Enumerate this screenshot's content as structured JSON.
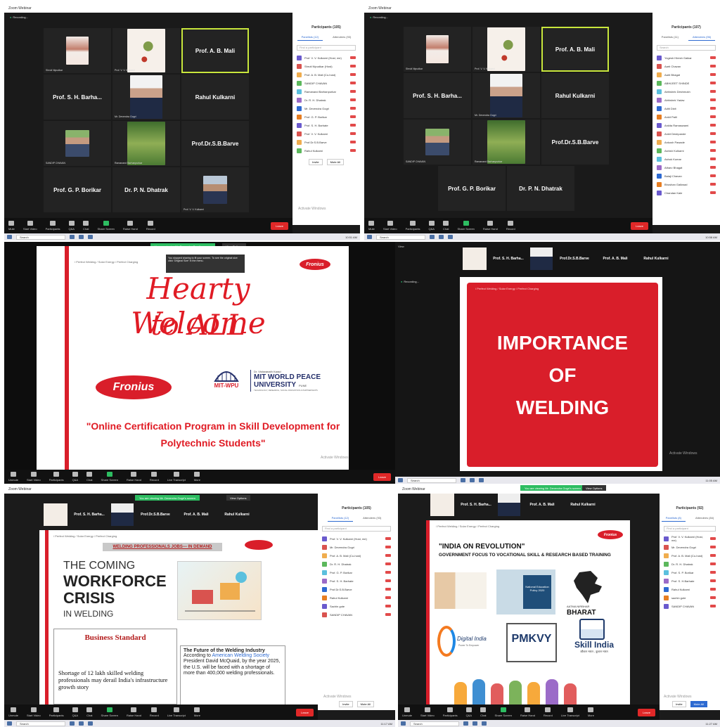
{
  "panel1": {
    "window_title": "Zoom Webinar",
    "recording": "Recording...",
    "tiles": [
      {
        "kind": "photo",
        "photo": "woman",
        "name": "Shruti Nipudkar"
      },
      {
        "kind": "photo",
        "photo": "bird",
        "name": "Prof. V. V. Kulkarni"
      },
      {
        "kind": "text",
        "label": "Prof. A. B. Mali",
        "active": true
      },
      {
        "kind": "text",
        "label": "Prof. S. H. Barha..."
      },
      {
        "kind": "photo",
        "photo": "suit",
        "name": "Mr. Devendra Gogri"
      },
      {
        "kind": "text",
        "label": "Rahul Kulkarni"
      },
      {
        "kind": "photo",
        "photo": "green",
        "name": "SANDIP CHAVAN"
      },
      {
        "kind": "photo",
        "photo": "outdoor",
        "name": "Ramanand Barhanpurkar"
      },
      {
        "kind": "text",
        "label": "Prof.Dr.S.B.Barve"
      },
      {
        "kind": "text",
        "label": "Prof. G. P. Borikar"
      },
      {
        "kind": "text",
        "label": "Dr. P. N. Dhatrak"
      },
      {
        "kind": "photo",
        "photo": "man2",
        "name": "Prof. V. V. Kulkarni"
      }
    ],
    "participants_title": "Participants (105)",
    "tab_panelists": "Panelists (12)",
    "tab_attendees": "Attendees (93)",
    "search_placeholder": "Find a participant",
    "participants": [
      "Prof. V. V. Kulkarni (Host, me)",
      "Shruti Nipudkar (Host)",
      "Prof. A. B. Mali (Co-host)",
      "SANDIP CHAVAN",
      "Ramanand Barhanpurkar",
      "Dr. R. H. Dhatrak",
      "Mr. Devendra Gogri",
      "Prof. G. P. Borikar",
      "Prof. S. H. Barhate",
      "Prof. V. V. Kulkarni",
      "Prof.Dr.S.B.Barve",
      "Rahul Kulkarni"
    ],
    "invite": "Invite",
    "mute_all": "Mute All",
    "toolbar": [
      "Mute",
      "Start Video",
      "Participants",
      "Q&A",
      "Chat",
      "Share Screen",
      "Raise Hand",
      "Record"
    ],
    "participant_count": "105",
    "leave": "Leave",
    "activate": "Activate Windows",
    "search": "Search",
    "time": "10:51 AM"
  },
  "panel2": {
    "window_title": "Zoom Webinar",
    "recording": "Recording...",
    "tiles": [
      {
        "kind": "photo",
        "photo": "woman",
        "name": "Shruti Nipudkar"
      },
      {
        "kind": "photo",
        "photo": "bird",
        "name": "Prof. V. V. Kulkarni"
      },
      {
        "kind": "text",
        "label": "Prof. A. B. Mali",
        "active": true
      },
      {
        "kind": "text",
        "label": "Prof. S. H. Barha..."
      },
      {
        "kind": "photo",
        "photo": "suit",
        "name": "Mr. Devendra Gogri"
      },
      {
        "kind": "text",
        "label": "Rahul Kulkarni"
      },
      {
        "kind": "photo",
        "photo": "green",
        "name": "SANDIP CHAVAN"
      },
      {
        "kind": "photo",
        "photo": "outdoor",
        "name": "Ramanand Barhanpurkar"
      },
      {
        "kind": "text",
        "label": "Prof.Dr.S.B.Barve"
      },
      {
        "kind": "text",
        "label": "Prof. G. P. Borikar"
      },
      {
        "kind": "text",
        "label": "Dr. P. N. Dhatrak"
      }
    ],
    "participants_title": "Participants (107)",
    "tab_panelists": "Panelists (11)",
    "tab_attendees": "Attendees (96)",
    "search_placeholder": "Search",
    "participants": [
      "Yogesh Hiresh Gaikar",
      "Aarti Chavan",
      "Aarti Bhagat",
      "ABHIJEET SHINDE",
      "Abhishek Deshmukh",
      "Abhishek Yadav",
      "Aditi Dixit",
      "Ankit Patil",
      "Ankita Ramaswami",
      "Ankit Deshpande",
      "Ankush Pawade",
      "Ashish Kulkarni",
      "Ashok Kumar",
      "Atharv Bhagat",
      "Balaji Chavan",
      "Bhushan Gaikwad",
      "Chandan Kale"
    ],
    "toolbar": [
      "Mute",
      "Start Video",
      "Participants",
      "Q&A",
      "Chat",
      "Share Screen",
      "Raise Hand",
      "Record"
    ],
    "leave": "Leave",
    "search": "Search",
    "time": "10:58 AM"
  },
  "panel3": {
    "share_banner": "You are viewing Mr. Devendra Gogri's screen",
    "view_options": "View Options",
    "notice": "You stopped sharing to fit your screen. To see the original size click 'Original Size' in the menu.",
    "tagline": "/ Perfect Welding / Solar Energy / Perfect Charging",
    "line1": "Hearty Welcome",
    "line2": "to ALL",
    "fronius": "Fronius",
    "fronius_sub": "SHIFTING THE LIMITS",
    "mit_small": "Dr. Vishwanath Karad",
    "mit_name_1": "MIT WORLD PEACE",
    "mit_name_2": "UNIVERSITY",
    "mit_city": "PUNE",
    "mit_tag": "TECHNOLOGY, RESEARCH, SOCIAL INNOVATION & PARTNERSHIPS",
    "mitwpu": "MIT-WPU",
    "program_1": "\"Online Certification Program in Skill Development for",
    "program_2": "Polytechnic Students\"",
    "activate": "Activate Windows",
    "toolbar": [
      "Unmute",
      "Start Video",
      "Participants",
      "Q&A",
      "Chat",
      "Share Screen",
      "Raise Hand",
      "Record",
      "Live Transcript",
      "More"
    ],
    "leave": "Leave"
  },
  "panel4": {
    "strip": [
      "Prof. S. H. Barha...",
      "Prof.Dr.S.B.Barve",
      "Prof. A. B. Mali",
      "Rahul Kulkarni"
    ],
    "recording": "Recording...",
    "view": "View",
    "tagline": "/ Perfect Welding / Solar Energy / Perfect Charging",
    "title_1": "IMPORTANCE",
    "title_2": "OF",
    "title_3": "WELDING",
    "activate": "Activate Windows",
    "search": "Search",
    "time": "11:05 AM"
  },
  "panel5": {
    "window_title": "Zoom Webinar",
    "share_banner": "You are viewing Mr. Devendra Gogri's screen",
    "view_options": "View Options",
    "strip": [
      "Prof. S. H. Barha...",
      "Prof.Dr.S.B.Barve",
      "Prof. A. B. Mali",
      "Rahul Kulkarni"
    ],
    "tagline": "/ Perfect Welding / Solar Energy / Perfect Charging",
    "banner": "WELDING PROFESSIONALS JOBS--- IN DEMAND",
    "coming": "THE COMING",
    "workforce": "WORKFORCE",
    "crisis": "CRISIS",
    "in_welding": "IN WELDING",
    "bs": "Business Standard",
    "headline": "Shortage of 12 lakh skilled welding professionals may derail India's infrastructure growth story",
    "future_title": "The Future of the Welding Industry",
    "future_1": "According to",
    "future_link": "American Welding Society",
    "future_2": "President David McQuaid, by the year 2025, the U.S. will be faced with a shortage of more than 400,000 welding professionals.",
    "participants_title": "Participants (105)",
    "tab_panelists": "Panelists (12)",
    "tab_attendees": "Attendees (93)",
    "search_placeholder": "Find a participant",
    "participants": [
      "Prof. V. V. Kulkarni (Host, me)",
      "Mr. Devendra Gogri",
      "Prof. A. B. Mali (Co-host)",
      "Dr. R. H. Dhatrak",
      "Prof. G. P. Borikar",
      "Prof. S. H. Barhate",
      "Prof.Dr.S.B.Barve",
      "Rahul Kulkarni",
      "Sachin gote",
      "SANDIP CHAVAN"
    ],
    "invite": "Invite",
    "mute_all": "Mute All",
    "activate": "Activate Windows",
    "toolbar": [
      "Unmute",
      "Start Video",
      "Participants",
      "Q&A",
      "Chat",
      "Share Screen",
      "Raise Hand",
      "Record",
      "Live Transcript",
      "More"
    ],
    "leave": "Leave",
    "search": "Search",
    "time": "11:17 AM"
  },
  "panel6": {
    "window_title": "Zoom Webinar",
    "share_banner": "You are viewing Mr. Devendra Gogri's screen",
    "view_options": "View Options",
    "strip": [
      "Prof. S. H. Barha...",
      "Prof. A. B. Mali",
      "Rahul Kulkarni"
    ],
    "tagline": "/ Perfect Welding / Solar Energy / Perfect Charging",
    "title": "\"INDIA ON REVOLUTION\"",
    "subtitle": "GOVERNMENT FOCUS TO VOCATIONAL SKILL & RESEARCH BASED TRAINING",
    "nep": "National Education Policy 2020",
    "atma": "AATMA NIRBHAR",
    "bharat": "BHARAT",
    "digital": "Digital India",
    "digital_sub": "Power To Empower",
    "pmkvy": "PMKVY",
    "skill": "Skill India",
    "skill_sub": "कौशल भारत - कुशल भारत",
    "participants_title": "Participants (92)",
    "tab_panelists": "Panelists (8)",
    "tab_attendees": "Attendees (84)",
    "search_placeholder": "Find a participant",
    "participants": [
      "Prof. V. V. Kulkarni (Host, me)",
      "Mr. Devendra Gogri",
      "Prof. A. B. Mali (Co-host)",
      "Dr. R. H. Dhatrak",
      "Prof. S. P. Borikar",
      "Prof. S. H.Barhate",
      "Rahul Kulkarni",
      "sachin gote",
      "SANDIP CHAVAN"
    ],
    "invite": "Invite",
    "mute_all": "Mute All",
    "activate": "Activate Windows",
    "toolbar": [
      "Unmute",
      "Start Video",
      "Participants",
      "Q&A",
      "Chat",
      "Share Screen",
      "Raise Hand",
      "Record",
      "Live Transcript",
      "More"
    ],
    "leave": "Leave",
    "search": "Search",
    "time": "11:27 AM"
  },
  "colors": {
    "zoom_blue": "#2d6ad1",
    "fronius_red": "#d91e2a",
    "active_border": "#c8e63c",
    "share_green": "#2dbd61"
  }
}
